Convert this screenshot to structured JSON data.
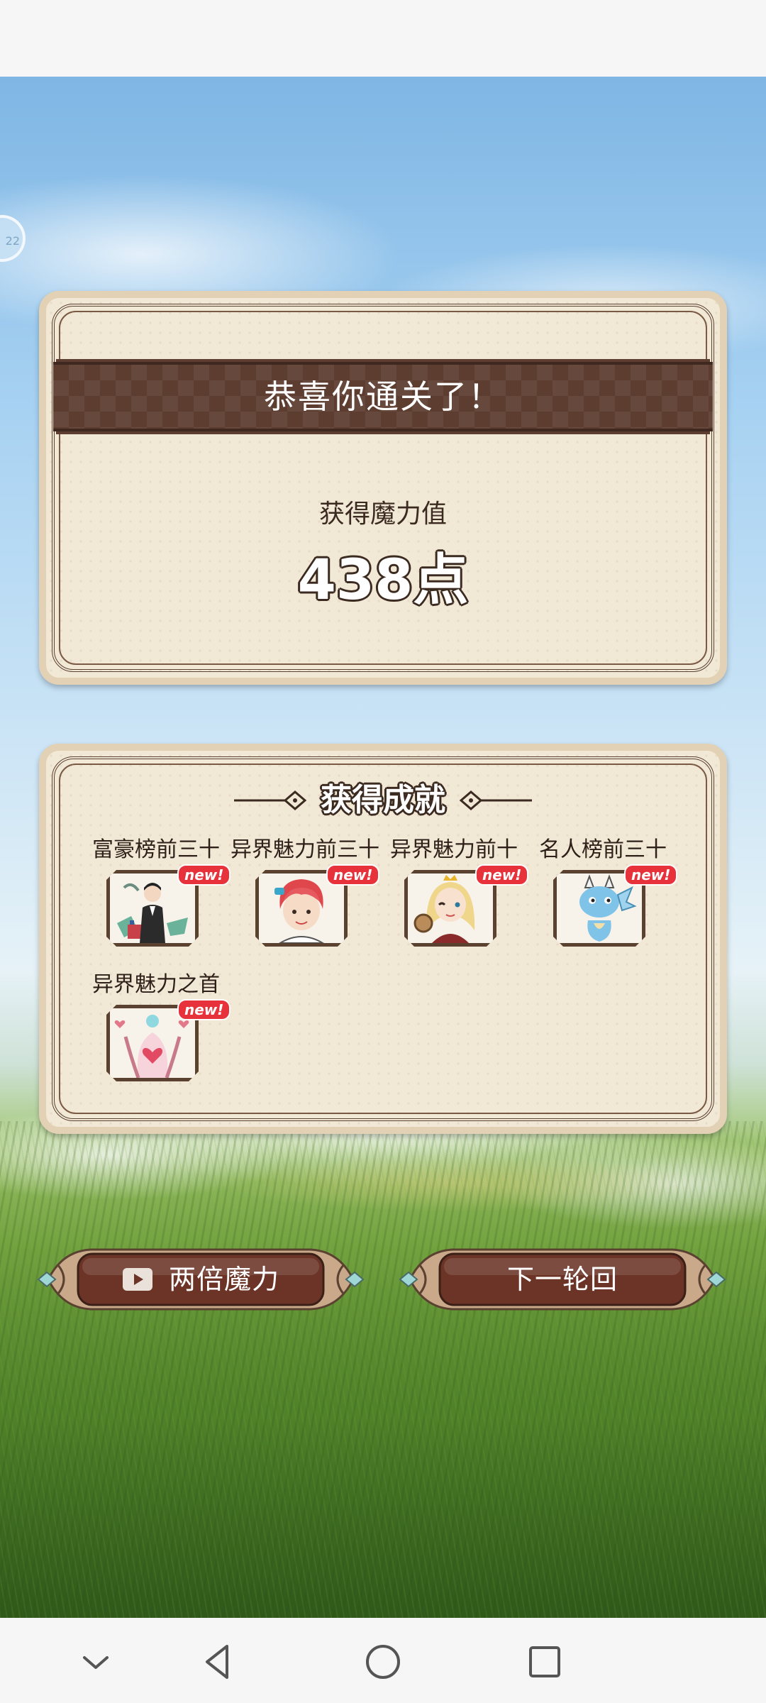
{
  "result_card": {
    "title": "恭喜你通关了！",
    "gain_label": "获得魔力值",
    "points": "438点"
  },
  "achievements": {
    "header": "获得成就",
    "new_badge": "new!",
    "items": [
      {
        "name": "富豪榜前三十",
        "icon": "man-in-suit-icon"
      },
      {
        "name": "异界魅力前三十",
        "icon": "red-haired-character-icon"
      },
      {
        "name": "异界魅力前十",
        "icon": "blonde-princess-icon"
      },
      {
        "name": "名人榜前三十",
        "icon": "blue-dragon-icon"
      },
      {
        "name": "异界魅力之首",
        "icon": "heart-dress-character-icon"
      }
    ]
  },
  "buttons": {
    "double": "两倍魔力",
    "next": "下一轮回"
  },
  "colors": {
    "banner": "#5c3d30",
    "card": "#f2e8d6",
    "button": "#6b3426",
    "badge": "#e8323b"
  }
}
